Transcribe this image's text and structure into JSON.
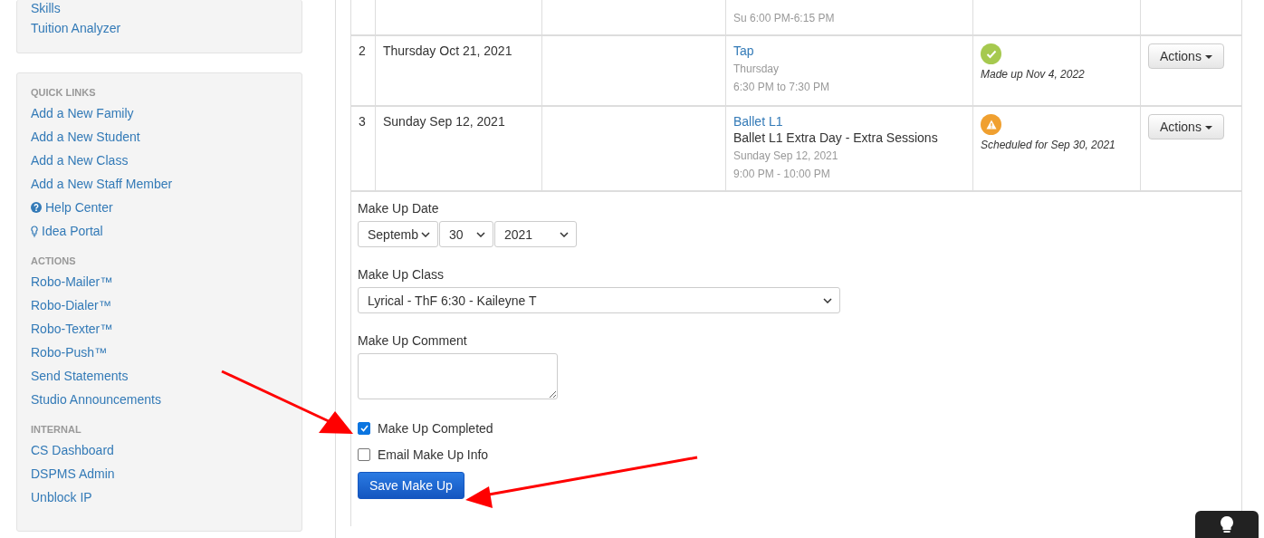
{
  "sidebar": {
    "top_links": [
      "Skills",
      "Tuition Analyzer"
    ],
    "sections": [
      {
        "heading": "QUICK LINKS",
        "items": [
          {
            "label": "Add a New Family"
          },
          {
            "label": "Add a New Student"
          },
          {
            "label": "Add a New Class"
          },
          {
            "label": "Add a New Staff Member"
          },
          {
            "label": "Help Center",
            "kind": "help"
          },
          {
            "label": "Idea Portal",
            "kind": "idea"
          }
        ]
      },
      {
        "heading": "ACTIONS",
        "items": [
          {
            "label": "Robo-Mailer™"
          },
          {
            "label": "Robo-Dialer™"
          },
          {
            "label": "Robo-Texter™"
          },
          {
            "label": "Robo-Push™"
          },
          {
            "label": "Send Statements"
          },
          {
            "label": "Studio Announcements"
          }
        ]
      },
      {
        "heading": "INTERNAL",
        "items": [
          {
            "label": "CS Dashboard"
          },
          {
            "label": "DSPMS Admin"
          },
          {
            "label": "Unblock IP"
          }
        ]
      }
    ]
  },
  "table": {
    "rows": [
      {
        "class_lines": [
          "Su 6:00 PM-6:15 PM"
        ]
      },
      {
        "number": "2",
        "date": "Thursday Oct 21, 2021",
        "class_link": "Tap",
        "class_lines": [
          "Thursday",
          "6:30 PM to 7:30 PM"
        ],
        "kind": "done",
        "status_text": "Made up Nov 4, 2022",
        "action": "Actions"
      },
      {
        "number": "3",
        "date": "Sunday Sep 12, 2021",
        "class_link": "Ballet L1",
        "class_detail": "Ballet L1 Extra Day - Extra Sessions",
        "class_lines": [
          "Sunday Sep 12, 2021",
          "9:00 PM - 10:00 PM"
        ],
        "kind": "scheduled",
        "status_text": "Scheduled for Sep 30, 2021",
        "action": "Actions"
      }
    ]
  },
  "form": {
    "date_label": "Make Up Date",
    "month": "Septemb",
    "day": "30",
    "year": "2021",
    "class_label": "Make Up Class",
    "class_value": "Lyrical - ThF 6:30 - Kaileyne T",
    "comment_label": "Make Up Comment",
    "checkboxes": [
      {
        "label": "Make Up Completed",
        "checked": true
      },
      {
        "label": "Email Make Up Info",
        "checked": false
      }
    ],
    "save_button": "Save Make Up"
  }
}
